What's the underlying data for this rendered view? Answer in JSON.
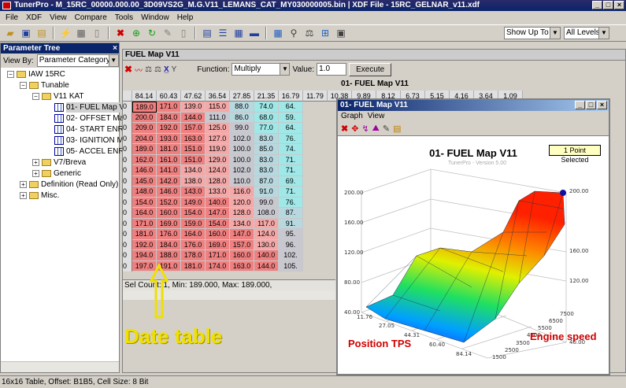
{
  "app": {
    "title": "TunerPro - M_15RC_00000.000.00_3D09VS2G_M.G.V11_LEMANS_CAT_MY030000005.bin | XDF File - 15RC_GELNAR_v11.xdf"
  },
  "menu": [
    "File",
    "XDF",
    "View",
    "Compare",
    "Tools",
    "Window",
    "Help"
  ],
  "toolbar": {
    "show_up_to": "Show Up To",
    "levels": "All Levels"
  },
  "param_tree": {
    "title": "Parameter Tree",
    "view_by_label": "View By:",
    "view_by_value": "Parameter Category",
    "nodes": [
      {
        "label": "IAW 15RC"
      },
      {
        "label": "Tunable"
      },
      {
        "label": "V11 KAT"
      },
      {
        "label": "01- FUEL Map V1"
      },
      {
        "label": "02- OFFSET Map"
      },
      {
        "label": "04- START ENRI"
      },
      {
        "label": "03- IGNITION M"
      },
      {
        "label": "05- ACCEL ENRI"
      },
      {
        "label": "V7/Breva"
      },
      {
        "label": "Generic"
      },
      {
        "label": "Definition (Read Only)"
      },
      {
        "label": "Misc."
      }
    ]
  },
  "fuel": {
    "window_title": "FUEL Map V11",
    "function_label": "Function:",
    "function_value": "Multiply",
    "value_label": "Value:",
    "value_value": "1.0",
    "execute": "Execute",
    "table_title": "01- FUEL Map V11",
    "col_headers": [
      "84.14",
      "60.43",
      "47.62",
      "36.54",
      "27.85",
      "21.35",
      "16.79",
      "11.79",
      "10.38",
      "9.89",
      "8.12",
      "6.73",
      "5.15",
      "4.16",
      "3.64",
      "1.09"
    ],
    "row_header": "0",
    "rows": [
      [
        "189.0",
        "171.0",
        "139.0",
        "115.0",
        "88.0",
        "74.0",
        "64."
      ],
      [
        "200.0",
        "184.0",
        "144.0",
        "111.0",
        "86.0",
        "68.0",
        "59."
      ],
      [
        "209.0",
        "192.0",
        "157.0",
        "125.0",
        "99.0",
        "77.0",
        "64."
      ],
      [
        "204.0",
        "193.0",
        "163.0",
        "127.0",
        "102.0",
        "83.0",
        "76."
      ],
      [
        "189.0",
        "181.0",
        "151.0",
        "119.0",
        "100.0",
        "85.0",
        "74."
      ],
      [
        "162.0",
        "161.0",
        "151.0",
        "129.0",
        "100.0",
        "83.0",
        "71."
      ],
      [
        "146.0",
        "141.0",
        "134.0",
        "124.0",
        "102.0",
        "83.0",
        "71."
      ],
      [
        "145.0",
        "142.0",
        "138.0",
        "128.0",
        "110.0",
        "87.0",
        "69."
      ],
      [
        "148.0",
        "146.0",
        "143.0",
        "133.0",
        "116.0",
        "91.0",
        "71."
      ],
      [
        "154.0",
        "152.0",
        "149.0",
        "140.0",
        "120.0",
        "99.0",
        "76."
      ],
      [
        "164.0",
        "160.0",
        "154.0",
        "147.0",
        "128.0",
        "108.0",
        "87."
      ],
      [
        "171.0",
        "169.0",
        "159.0",
        "154.0",
        "134.0",
        "117.0",
        "91."
      ],
      [
        "181.0",
        "176.0",
        "164.0",
        "160.0",
        "147.0",
        "124.0",
        "95."
      ],
      [
        "192.0",
        "184.0",
        "176.0",
        "169.0",
        "157.0",
        "130.0",
        "96."
      ],
      [
        "194.0",
        "188.0",
        "178.0",
        "171.0",
        "160.0",
        "140.0",
        "102."
      ],
      [
        "197.0",
        "191.0",
        "181.0",
        "174.0",
        "163.0",
        "144.0",
        "105."
      ]
    ],
    "status": "Sel Count: 1, Min: 189.000, Max: 189.000,"
  },
  "graph": {
    "window_title": "01- FUEL Map V11",
    "menu": [
      "Graph",
      "View"
    ],
    "chart_title": "01- FUEL Map V11",
    "selected_badge": "1 Point Selected",
    "version": "TunerPro - Version 5.00",
    "z_ticks": [
      "40.00",
      "80.00",
      "120.00",
      "160.00",
      "200.00"
    ],
    "tps_ticks": [
      "11.76",
      "27.05",
      "44.31",
      "60.40",
      "84.14"
    ],
    "rpm_ticks": [
      "1500",
      "2500",
      "3500",
      "4500",
      "5500",
      "6500",
      "7500"
    ]
  },
  "annotations": {
    "date_table": "Date table",
    "position_tps": "Position TPS",
    "engine_speed": "Engine speed"
  },
  "statusbar": "16x16 Table, Offset: B1B5, Cell Size: 8 Bit",
  "colors": {
    "title_blue": "#0a246a",
    "annotation_yellow": "#f0e000",
    "annotation_red": "#d00000"
  }
}
